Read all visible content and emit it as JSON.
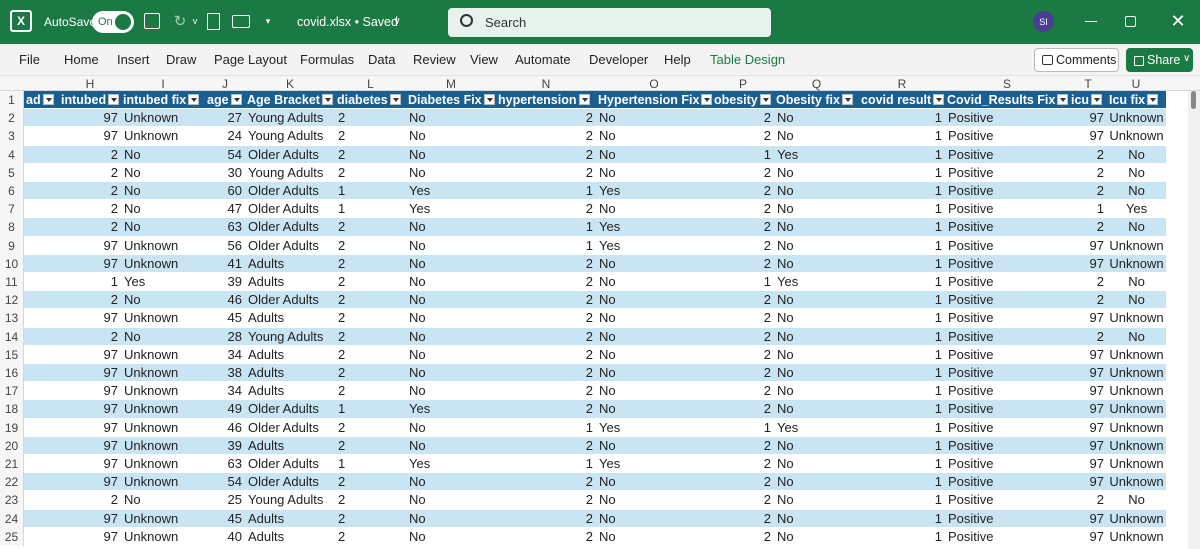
{
  "app": {
    "autosave_label": "AutoSave",
    "autosave_state": "On",
    "file_title": "covid.xlsx • Saved",
    "search_placeholder": "Search",
    "user_initials": "SI"
  },
  "ribbon": {
    "tabs": [
      "File",
      "Home",
      "Insert",
      "Draw",
      "Page Layout",
      "Formulas",
      "Data",
      "Review",
      "View",
      "Automate",
      "Developer",
      "Help",
      "Table Design"
    ],
    "comments_label": "Comments",
    "share_label": "Share"
  },
  "columns": [
    "H",
    "I",
    "J",
    "K",
    "L",
    "M",
    "N",
    "O",
    "P",
    "Q",
    "R",
    "S",
    "T",
    "U"
  ],
  "headers": [
    "ad",
    "intubed",
    "intubed fix",
    "age",
    "Age Bracket",
    "diabetes",
    "Diabetes Fix",
    "hypertension",
    "Hypertension Fix",
    "obesity",
    "Obesity fix",
    "covid result",
    "Covid_Results Fix",
    "icu",
    "Icu fix"
  ],
  "rows": [
    {
      "n": "2",
      "d": [
        "",
        "97",
        "Unknown",
        "27",
        "Young Adults",
        "2",
        "No",
        "2",
        "No",
        "2",
        "No",
        "1",
        "Positive",
        "97",
        "Unknown"
      ]
    },
    {
      "n": "3",
      "d": [
        "",
        "97",
        "Unknown",
        "24",
        "Young Adults",
        "2",
        "No",
        "2",
        "No",
        "2",
        "No",
        "1",
        "Positive",
        "97",
        "Unknown"
      ]
    },
    {
      "n": "4",
      "d": [
        "",
        "2",
        "No",
        "54",
        "Older Adults",
        "2",
        "No",
        "2",
        "No",
        "1",
        "Yes",
        "1",
        "Positive",
        "2",
        "No"
      ]
    },
    {
      "n": "5",
      "d": [
        "",
        "2",
        "No",
        "30",
        "Young Adults",
        "2",
        "No",
        "2",
        "No",
        "2",
        "No",
        "1",
        "Positive",
        "2",
        "No"
      ]
    },
    {
      "n": "6",
      "d": [
        "",
        "2",
        "No",
        "60",
        "Older Adults",
        "1",
        "Yes",
        "1",
        "Yes",
        "2",
        "No",
        "1",
        "Positive",
        "2",
        "No"
      ]
    },
    {
      "n": "7",
      "d": [
        "",
        "2",
        "No",
        "47",
        "Older Adults",
        "1",
        "Yes",
        "2",
        "No",
        "2",
        "No",
        "1",
        "Positive",
        "1",
        "Yes"
      ]
    },
    {
      "n": "8",
      "d": [
        "",
        "2",
        "No",
        "63",
        "Older Adults",
        "2",
        "No",
        "1",
        "Yes",
        "2",
        "No",
        "1",
        "Positive",
        "2",
        "No"
      ]
    },
    {
      "n": "9",
      "d": [
        "",
        "97",
        "Unknown",
        "56",
        "Older Adults",
        "2",
        "No",
        "1",
        "Yes",
        "2",
        "No",
        "1",
        "Positive",
        "97",
        "Unknown"
      ]
    },
    {
      "n": "10",
      "d": [
        "",
        "97",
        "Unknown",
        "41",
        "Adults",
        "2",
        "No",
        "2",
        "No",
        "2",
        "No",
        "1",
        "Positive",
        "97",
        "Unknown"
      ]
    },
    {
      "n": "11",
      "d": [
        "",
        "1",
        "Yes",
        "39",
        "Adults",
        "2",
        "No",
        "2",
        "No",
        "1",
        "Yes",
        "1",
        "Positive",
        "2",
        "No"
      ]
    },
    {
      "n": "12",
      "d": [
        "",
        "2",
        "No",
        "46",
        "Older Adults",
        "2",
        "No",
        "2",
        "No",
        "2",
        "No",
        "1",
        "Positive",
        "2",
        "No"
      ]
    },
    {
      "n": "13",
      "d": [
        "",
        "97",
        "Unknown",
        "45",
        "Adults",
        "2",
        "No",
        "2",
        "No",
        "2",
        "No",
        "1",
        "Positive",
        "97",
        "Unknown"
      ]
    },
    {
      "n": "14",
      "d": [
        "",
        "2",
        "No",
        "28",
        "Young Adults",
        "2",
        "No",
        "2",
        "No",
        "2",
        "No",
        "1",
        "Positive",
        "2",
        "No"
      ]
    },
    {
      "n": "15",
      "d": [
        "",
        "97",
        "Unknown",
        "34",
        "Adults",
        "2",
        "No",
        "2",
        "No",
        "2",
        "No",
        "1",
        "Positive",
        "97",
        "Unknown"
      ]
    },
    {
      "n": "16",
      "d": [
        "",
        "97",
        "Unknown",
        "38",
        "Adults",
        "2",
        "No",
        "2",
        "No",
        "2",
        "No",
        "1",
        "Positive",
        "97",
        "Unknown"
      ]
    },
    {
      "n": "17",
      "d": [
        "",
        "97",
        "Unknown",
        "34",
        "Adults",
        "2",
        "No",
        "2",
        "No",
        "2",
        "No",
        "1",
        "Positive",
        "97",
        "Unknown"
      ]
    },
    {
      "n": "18",
      "d": [
        "",
        "97",
        "Unknown",
        "49",
        "Older Adults",
        "1",
        "Yes",
        "2",
        "No",
        "2",
        "No",
        "1",
        "Positive",
        "97",
        "Unknown"
      ]
    },
    {
      "n": "19",
      "d": [
        "",
        "97",
        "Unknown",
        "46",
        "Older Adults",
        "2",
        "No",
        "1",
        "Yes",
        "1",
        "Yes",
        "1",
        "Positive",
        "97",
        "Unknown"
      ]
    },
    {
      "n": "20",
      "d": [
        "",
        "97",
        "Unknown",
        "39",
        "Adults",
        "2",
        "No",
        "2",
        "No",
        "2",
        "No",
        "1",
        "Positive",
        "97",
        "Unknown"
      ]
    },
    {
      "n": "21",
      "d": [
        "",
        "97",
        "Unknown",
        "63",
        "Older Adults",
        "1",
        "Yes",
        "1",
        "Yes",
        "2",
        "No",
        "1",
        "Positive",
        "97",
        "Unknown"
      ]
    },
    {
      "n": "22",
      "d": [
        "",
        "97",
        "Unknown",
        "54",
        "Older Adults",
        "2",
        "No",
        "2",
        "No",
        "2",
        "No",
        "1",
        "Positive",
        "97",
        "Unknown"
      ]
    },
    {
      "n": "23",
      "d": [
        "",
        "2",
        "No",
        "25",
        "Young Adults",
        "2",
        "No",
        "2",
        "No",
        "2",
        "No",
        "1",
        "Positive",
        "2",
        "No"
      ]
    },
    {
      "n": "24",
      "d": [
        "",
        "97",
        "Unknown",
        "45",
        "Adults",
        "2",
        "No",
        "2",
        "No",
        "2",
        "No",
        "1",
        "Positive",
        "97",
        "Unknown"
      ]
    },
    {
      "n": "25",
      "d": [
        "",
        "97",
        "Unknown",
        "40",
        "Adults",
        "2",
        "No",
        "2",
        "No",
        "2",
        "No",
        "1",
        "Positive",
        "97",
        "Unknown"
      ]
    }
  ]
}
